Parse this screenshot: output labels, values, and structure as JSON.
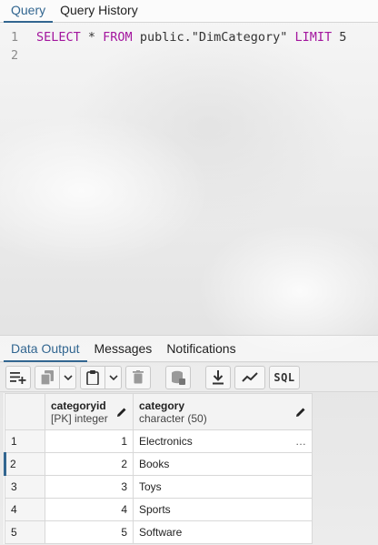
{
  "top_tabs": [
    {
      "label": "Query",
      "active": true
    },
    {
      "label": "Query History",
      "active": false
    }
  ],
  "editor": {
    "lines": [
      {
        "number": "1",
        "tokens": [
          {
            "text": "SELECT",
            "type": "kw"
          },
          {
            "text": " * ",
            "type": "plain"
          },
          {
            "text": "FROM",
            "type": "kw"
          },
          {
            "text": " public.\"DimCategory\" ",
            "type": "plain"
          },
          {
            "text": "LIMIT",
            "type": "kw"
          },
          {
            "text": " 5",
            "type": "plain"
          }
        ]
      },
      {
        "number": "2",
        "tokens": []
      }
    ]
  },
  "bottom_tabs": [
    {
      "label": "Data Output",
      "active": true
    },
    {
      "label": "Messages",
      "active": false
    },
    {
      "label": "Notifications",
      "active": false
    }
  ],
  "toolbar": {
    "icons": [
      "add-row-icon",
      "copy-icon",
      "paste-icon",
      "delete-icon",
      "save-data-icon",
      "download-icon",
      "graph-icon"
    ],
    "sql_label": "SQL"
  },
  "grid": {
    "columns": [
      {
        "name": "categoryid",
        "type": "[PK] integer"
      },
      {
        "name": "category",
        "type": "character (50)"
      }
    ],
    "rows": [
      {
        "rownum": "1",
        "categoryid": "1",
        "category": "Electronics",
        "ellipsis": "…"
      },
      {
        "rownum": "2",
        "categoryid": "2",
        "category": "Books"
      },
      {
        "rownum": "3",
        "categoryid": "3",
        "category": "Toys"
      },
      {
        "rownum": "4",
        "categoryid": "4",
        "category": "Sports"
      },
      {
        "rownum": "5",
        "categoryid": "5",
        "category": "Software"
      }
    ]
  },
  "colors": {
    "accent": "#326690",
    "keyword": "#a3169e"
  }
}
